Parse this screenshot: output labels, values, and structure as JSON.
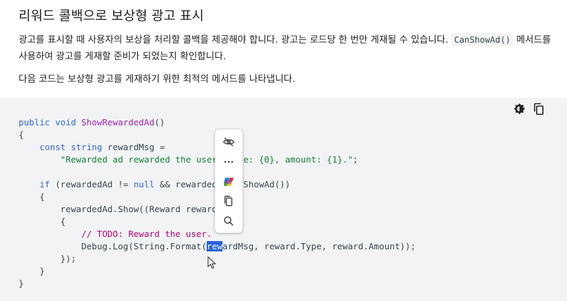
{
  "heading": "리워드 콜백으로 보상형 광고 표시",
  "para1": {
    "before": "광고를 표시할 때 사용자의 보상을 처리할 콜백을 제공해야 합니다. 광고는 로드당 한 번만 게재될 수 있습니다. ",
    "code": "CanShowAd()",
    "after": " 메서드를 사용하여 광고를 게재할 준비가 되었는지 확인합니다."
  },
  "para2": "다음 코드는 보상형 광고를 게재하기 위한 최적의 메서드를 나타냅니다.",
  "code": {
    "l1_kw": "public void",
    "l1_fn": "ShowRewardedAd",
    "l1_rest": "()",
    "l2": "{",
    "l3_kw": "const string",
    "l3_rest": " rewardMsg =",
    "l4_str": "\"Rewarded ad rewarded the user",
    "l4_str2": "e: {0}, amount: {1}.\"",
    "l4_rest": ";",
    "l6_kw": "if",
    "l6_a": " (rewardedAd != ",
    "l6_kw2": "null",
    "l6_b": " && rewardedA",
    "l6_c": "anShowAd())",
    "l7": "{",
    "l8": "rewardedAd.Show((Reward reward",
    "l9": "{",
    "l10_cm": "// TODO: Reward the user.",
    "l11_a": "Debug.Log(String.Format(",
    "l11_sel": "rew",
    "l11_b": "ardMsg, reward.Type, reward.Amount));",
    "l12": "});",
    "l13": "}",
    "l14": "}"
  },
  "icons": {
    "theme": "brightness-theme-icon",
    "copy": "copy-code-icon",
    "popup": [
      "hide-eye-icon",
      "more-dots-icon",
      "copilot-icon",
      "copy-icon",
      "search-icon"
    ]
  }
}
